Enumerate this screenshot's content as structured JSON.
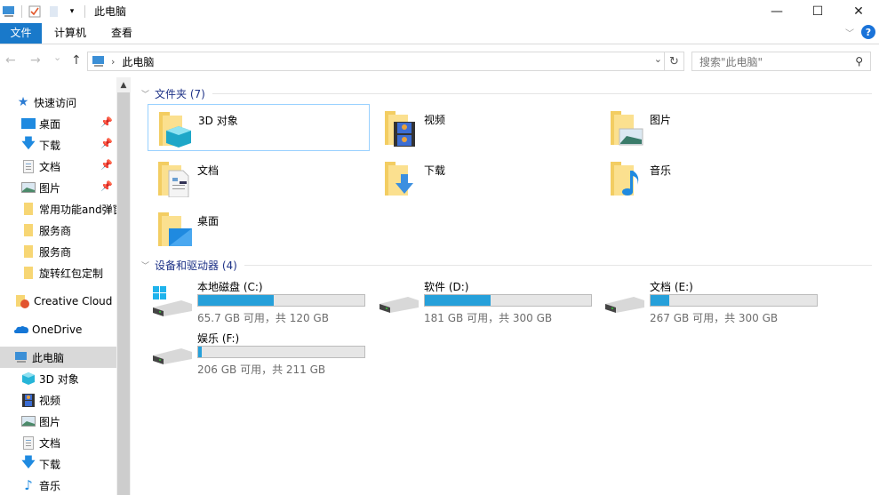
{
  "window": {
    "title": "此电脑",
    "controls": {
      "minimize": "—",
      "maximize": "☐",
      "close": "✕"
    }
  },
  "ribbon": {
    "tabs": [
      {
        "label": "文件"
      },
      {
        "label": "计算机"
      },
      {
        "label": "查看"
      }
    ],
    "help_label": "?"
  },
  "navigation": {
    "back": "←",
    "forward": "→",
    "recent": "⌄",
    "up": "↑",
    "address": "此电脑",
    "search_placeholder": "搜索\"此电脑\""
  },
  "sidebar": {
    "quick_access": "快速访问",
    "items": [
      {
        "label": "桌面",
        "icon": "desktop-icon",
        "pinned": true
      },
      {
        "label": "下载",
        "icon": "download-icon",
        "pinned": true
      },
      {
        "label": "文档",
        "icon": "document-icon",
        "pinned": true
      },
      {
        "label": "图片",
        "icon": "picture-icon",
        "pinned": true
      },
      {
        "label": "常用功能and弹窗",
        "icon": "folder-icon",
        "pinned": false
      },
      {
        "label": "服务商",
        "icon": "folder-icon",
        "pinned": false
      },
      {
        "label": "服务商",
        "icon": "folder-icon",
        "pinned": false
      },
      {
        "label": "旋转红包定制",
        "icon": "folder-icon",
        "pinned": false
      }
    ],
    "creative_cloud": "Creative Cloud Files",
    "onedrive": "OneDrive",
    "this_pc": "此电脑",
    "pc_items": [
      {
        "label": "3D 对象",
        "icon": "3d-objects-icon"
      },
      {
        "label": "视频",
        "icon": "video-icon"
      },
      {
        "label": "图片",
        "icon": "picture-icon"
      },
      {
        "label": "文档",
        "icon": "document-icon"
      },
      {
        "label": "下载",
        "icon": "download-icon"
      },
      {
        "label": "音乐",
        "icon": "music-icon"
      }
    ]
  },
  "folders": {
    "header": "文件夹 (7)",
    "items": [
      {
        "label": "3D 对象",
        "icon": "3d-objects-icon"
      },
      {
        "label": "视频",
        "icon": "video-icon"
      },
      {
        "label": "图片",
        "icon": "picture-icon"
      },
      {
        "label": "文档",
        "icon": "document-icon"
      },
      {
        "label": "下载",
        "icon": "download-icon"
      },
      {
        "label": "音乐",
        "icon": "music-icon"
      },
      {
        "label": "桌面",
        "icon": "desktop-icon"
      }
    ]
  },
  "drives": {
    "header": "设备和驱动器 (4)",
    "items": [
      {
        "name": "本地磁盘 (C:)",
        "info": "65.7 GB 可用，共 120 GB",
        "used_percent": 45.3,
        "system": true
      },
      {
        "name": "软件 (D:)",
        "info": "181 GB 可用，共 300 GB",
        "used_percent": 39.7,
        "system": false
      },
      {
        "name": "文档 (E:)",
        "info": "267 GB 可用，共 300 GB",
        "used_percent": 11.0,
        "system": false
      },
      {
        "name": "娱乐 (F:)",
        "info": "206 GB 可用，共 211 GB",
        "used_percent": 2.4,
        "system": false
      }
    ]
  },
  "colors": {
    "accent": "#1979ca",
    "bar_fill": "#26a0da",
    "group_header": "#1e3287"
  }
}
